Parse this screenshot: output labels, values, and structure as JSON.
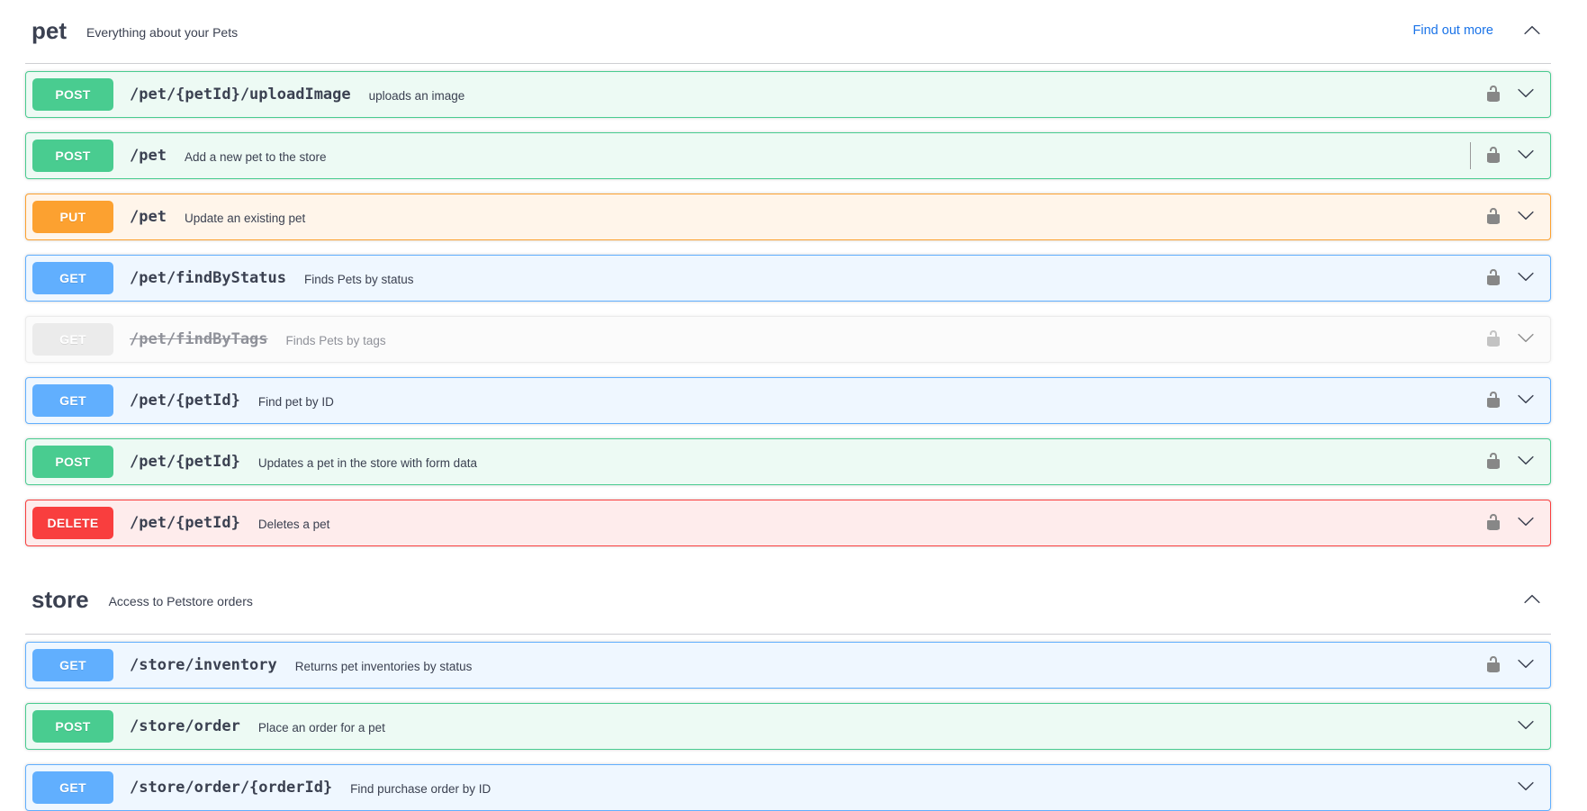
{
  "ui": {
    "link_color": "#1a73e8",
    "text_color": "#3b4151",
    "method_colors": {
      "GET": "#61affe",
      "POST": "#49cc90",
      "PUT": "#fca130",
      "DELETE": "#f93e3e",
      "DEPRECATED": "#ebebeb"
    },
    "icons": {
      "auth": "unlocked-padlock-icon",
      "expand": "chevron-down-icon",
      "collapse": "chevron-up-icon"
    }
  },
  "sections": [
    {
      "title": "pet",
      "description": "Everything about your Pets",
      "external_link": "Find out more",
      "collapsed": false,
      "operations": [
        {
          "method": "POST",
          "path": "/pet/{petId}/uploadImage",
          "summary": "uploads an image",
          "auth": true,
          "deprecated": false,
          "cursor": false
        },
        {
          "method": "POST",
          "path": "/pet",
          "summary": "Add a new pet to the store",
          "auth": true,
          "deprecated": false,
          "cursor": true
        },
        {
          "method": "PUT",
          "path": "/pet",
          "summary": "Update an existing pet",
          "auth": true,
          "deprecated": false,
          "cursor": false
        },
        {
          "method": "GET",
          "path": "/pet/findByStatus",
          "summary": "Finds Pets by status",
          "auth": true,
          "deprecated": false,
          "cursor": false
        },
        {
          "method": "GET",
          "path": "/pet/findByTags",
          "summary": "Finds Pets by tags",
          "auth": true,
          "deprecated": true,
          "cursor": false
        },
        {
          "method": "GET",
          "path": "/pet/{petId}",
          "summary": "Find pet by ID",
          "auth": true,
          "deprecated": false,
          "cursor": false
        },
        {
          "method": "POST",
          "path": "/pet/{petId}",
          "summary": "Updates a pet in the store with form data",
          "auth": true,
          "deprecated": false,
          "cursor": false
        },
        {
          "method": "DELETE",
          "path": "/pet/{petId}",
          "summary": "Deletes a pet",
          "auth": true,
          "deprecated": false,
          "cursor": false
        }
      ]
    },
    {
      "title": "store",
      "description": "Access to Petstore orders",
      "external_link": null,
      "collapsed": false,
      "operations": [
        {
          "method": "GET",
          "path": "/store/inventory",
          "summary": "Returns pet inventories by status",
          "auth": true,
          "deprecated": false,
          "cursor": false
        },
        {
          "method": "POST",
          "path": "/store/order",
          "summary": "Place an order for a pet",
          "auth": false,
          "deprecated": false,
          "cursor": false
        },
        {
          "method": "GET",
          "path": "/store/order/{orderId}",
          "summary": "Find purchase order by ID",
          "auth": false,
          "deprecated": false,
          "cursor": false
        }
      ]
    }
  ]
}
